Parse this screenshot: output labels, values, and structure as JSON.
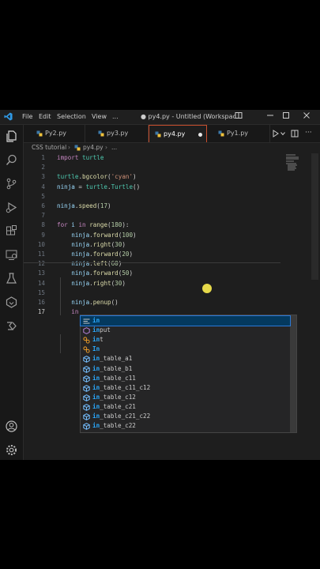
{
  "titlebar": {
    "menus": [
      "File",
      "Edit",
      "Selection",
      "View",
      "..."
    ],
    "window_title": "● py4.py - Untitled (Workspac..."
  },
  "activity_icons": [
    "files-icon",
    "search-icon",
    "source-control-icon",
    "run-debug-icon",
    "extensions-icon",
    "remote-explorer-icon",
    "testing-icon",
    "copilot-icon",
    "live-share-icon",
    "account-icon",
    "settings-gear-icon"
  ],
  "tabs": [
    {
      "label": "Py2.py",
      "active": false,
      "dirty": false
    },
    {
      "label": "py3.py",
      "active": false,
      "dirty": false
    },
    {
      "label": "py4.py",
      "active": true,
      "dirty": true
    },
    {
      "label": "Py1.py",
      "active": false,
      "dirty": false
    }
  ],
  "breadcrumb": [
    "CSS tutorial",
    "py4.py",
    "..."
  ],
  "code_lines": [
    {
      "n": "1",
      "text": "import turtle"
    },
    {
      "n": "2",
      "text": ""
    },
    {
      "n": "3",
      "text": "turtle.bgcolor('cyan')"
    },
    {
      "n": "4",
      "text": "ninja = turtle.Turtle()"
    },
    {
      "n": "5",
      "text": ""
    },
    {
      "n": "6",
      "text": "ninja.speed(17)"
    },
    {
      "n": "7",
      "text": ""
    },
    {
      "n": "8",
      "text": "for i in range(180):"
    },
    {
      "n": "9",
      "text": "    ninja.forward(100)"
    },
    {
      "n": "10",
      "text": "    ninja.right(30)"
    },
    {
      "n": "11",
      "text": "    ninja.forward(20)"
    },
    {
      "n": "12",
      "text": "    ninja.left(60)"
    },
    {
      "n": "13",
      "text": "    ninja.forward(50)"
    },
    {
      "n": "14",
      "text": "    ninja.right(30)"
    },
    {
      "n": "15",
      "text": ""
    },
    {
      "n": "16",
      "text": "    ninja.penup()"
    },
    {
      "n": "17",
      "text": "    in"
    }
  ],
  "suggestions": [
    {
      "label": "in",
      "kind": "keyword"
    },
    {
      "label": "input",
      "kind": "function"
    },
    {
      "label": "int",
      "kind": "class"
    },
    {
      "label": "In",
      "kind": "class"
    },
    {
      "label": "in_table_a1",
      "kind": "module"
    },
    {
      "label": "in_table_b1",
      "kind": "module"
    },
    {
      "label": "in_table_c11",
      "kind": "module"
    },
    {
      "label": "in_table_c11_c12",
      "kind": "module"
    },
    {
      "label": "in_table_c12",
      "kind": "module"
    },
    {
      "label": "in_table_c21",
      "kind": "module"
    },
    {
      "label": "in_table_c21_c22",
      "kind": "module"
    },
    {
      "label": "in_table_c22",
      "kind": "module"
    }
  ],
  "colors": {
    "accent": "#2aaaff",
    "keyword": "#c586c0",
    "function": "#dcdcaa",
    "variable": "#9cdcfe",
    "string": "#ce9178",
    "number": "#b5cea8",
    "tab_active_border": "#c84e2c"
  }
}
